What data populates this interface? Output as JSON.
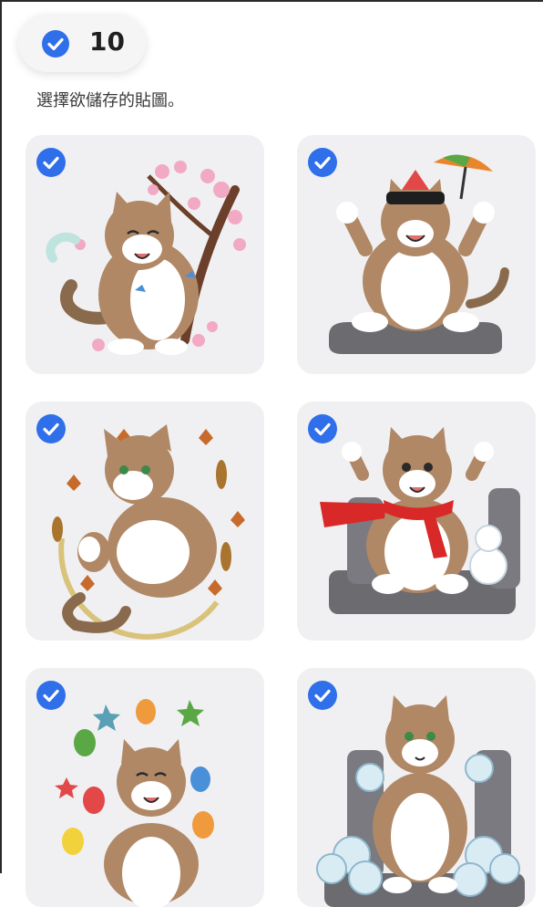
{
  "header": {
    "selected_count": "10",
    "instruction": "選擇欲儲存的貼圖。"
  },
  "stickers": [
    {
      "icon": "cat-cherry-blossom-sticker",
      "selected": true
    },
    {
      "icon": "cat-watermelon-umbrella-sticker",
      "selected": true
    },
    {
      "icon": "cat-autumn-leaves-sticker",
      "selected": true
    },
    {
      "icon": "cat-red-scarf-snowman-sticker",
      "selected": true
    },
    {
      "icon": "cat-balloons-party-sticker",
      "selected": true
    },
    {
      "icon": "cat-clouds-seat-sticker",
      "selected": true
    }
  ],
  "colors": {
    "accent": "#2f6fea",
    "card_bg": "#f0f0f2"
  }
}
